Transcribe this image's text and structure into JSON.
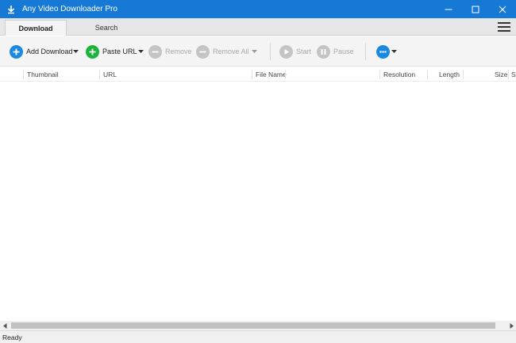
{
  "window": {
    "title": "Any Video Downloader Pro",
    "icons": {
      "app": "download-arrow-icon",
      "minimize": "minimize-icon",
      "maximize": "maximize-icon",
      "close": "close-icon"
    }
  },
  "tabs": [
    {
      "label": "Download",
      "active": true
    },
    {
      "label": "Search",
      "active": false
    }
  ],
  "toolbar": {
    "add_download": "Add Download",
    "paste_url": "Paste URL",
    "remove": "Remove",
    "remove_all": "Remove All",
    "start": "Start",
    "pause": "Pause"
  },
  "columns": [
    "Thumbnail",
    "URL",
    "File Name",
    "Resolution",
    "Length",
    "Size",
    "S"
  ],
  "status": {
    "text": "Ready"
  },
  "colors": {
    "titlebar": "#1679d6",
    "accent_blue": "#1a8ae0",
    "accent_green": "#1db33a",
    "disabled_gray": "#c4c4c4"
  }
}
